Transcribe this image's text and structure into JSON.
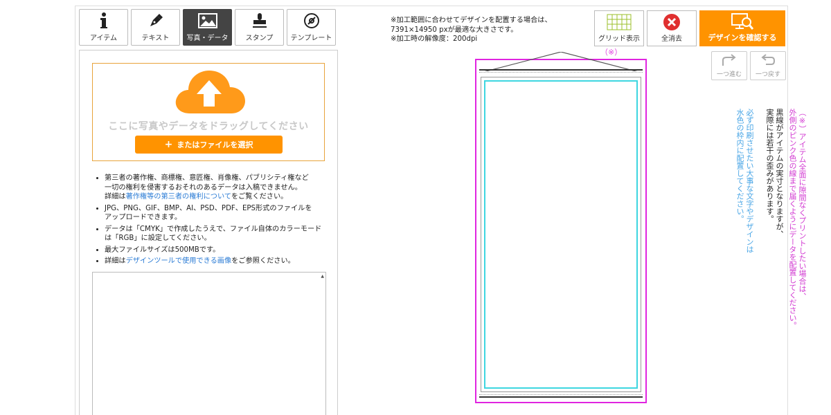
{
  "tabs": [
    {
      "label": "アイテム",
      "icon": "info-icon"
    },
    {
      "label": "テキスト",
      "icon": "pen-icon"
    },
    {
      "label": "写真・データ",
      "icon": "image-icon"
    },
    {
      "label": "スタンプ",
      "icon": "stamp-icon"
    },
    {
      "label": "テンプレート",
      "icon": "disc-icon"
    }
  ],
  "upload": {
    "drop_text": "ここに写真やデータをドラッグしてください",
    "button_label": "またはファイルを選択"
  },
  "notes": {
    "n1_line1": "第三者の著作権、商標権、意匠権、肖像権、パブリシティ権など",
    "n1_line2": "一切の権利を侵害するおそれのあるデータは入稿できません。",
    "n1_line3_pre": "詳細は",
    "n1_link": "著作権等の第三者の権利について",
    "n1_line3_post": "をご覧ください。",
    "n2_line1": "JPG、PNG、GIF、BMP、AI、PSD、PDF、EPS形式のファイルを",
    "n2_line2": "アップロードできます。",
    "n3_line1": "データは「CMYK」で作成したうえで、ファイル自体のカラーモード",
    "n3_line2": "は「RGB」に設定してください。",
    "n4": "最大ファイルサイズは500MBです。",
    "n5_pre": "詳細は",
    "n5_link": "デザインツールで使用できる画像",
    "n5_post": "をご参照ください。"
  },
  "info": {
    "line1": "※加工範囲に合わせてデザインを配置する場合は、",
    "line2": "7391×14950 pxが最適な大きさです。",
    "line3": "※加工時の解像度：200dpi"
  },
  "toolbar": {
    "grid_label": "グリッド表示",
    "clear_label": "全消去",
    "confirm_label": "デザインを確認する",
    "redo_label": "一つ進む",
    "undo_label": "一つ戻す"
  },
  "canvas": {
    "asterisk": "（※）",
    "pink_note_1": "（※）アイテム全面に隙間なくプリントしたい場合は、",
    "pink_note_2": "外側のピンク色の線まで届くようにデータを配置してください。",
    "black_note_1": "黒線がアイテムの実寸となりますが、",
    "black_note_2": "実際には若干の歪みがあります。",
    "blue_note_1": "必ず印刷させたい大事な文字やデザインは",
    "blue_note_2": "水色の枠内に配置してください。"
  },
  "colors": {
    "accent": "#ff9300",
    "pink": "#e024e0",
    "cyan": "#3dd6e0",
    "link": "#2a7bd5"
  }
}
